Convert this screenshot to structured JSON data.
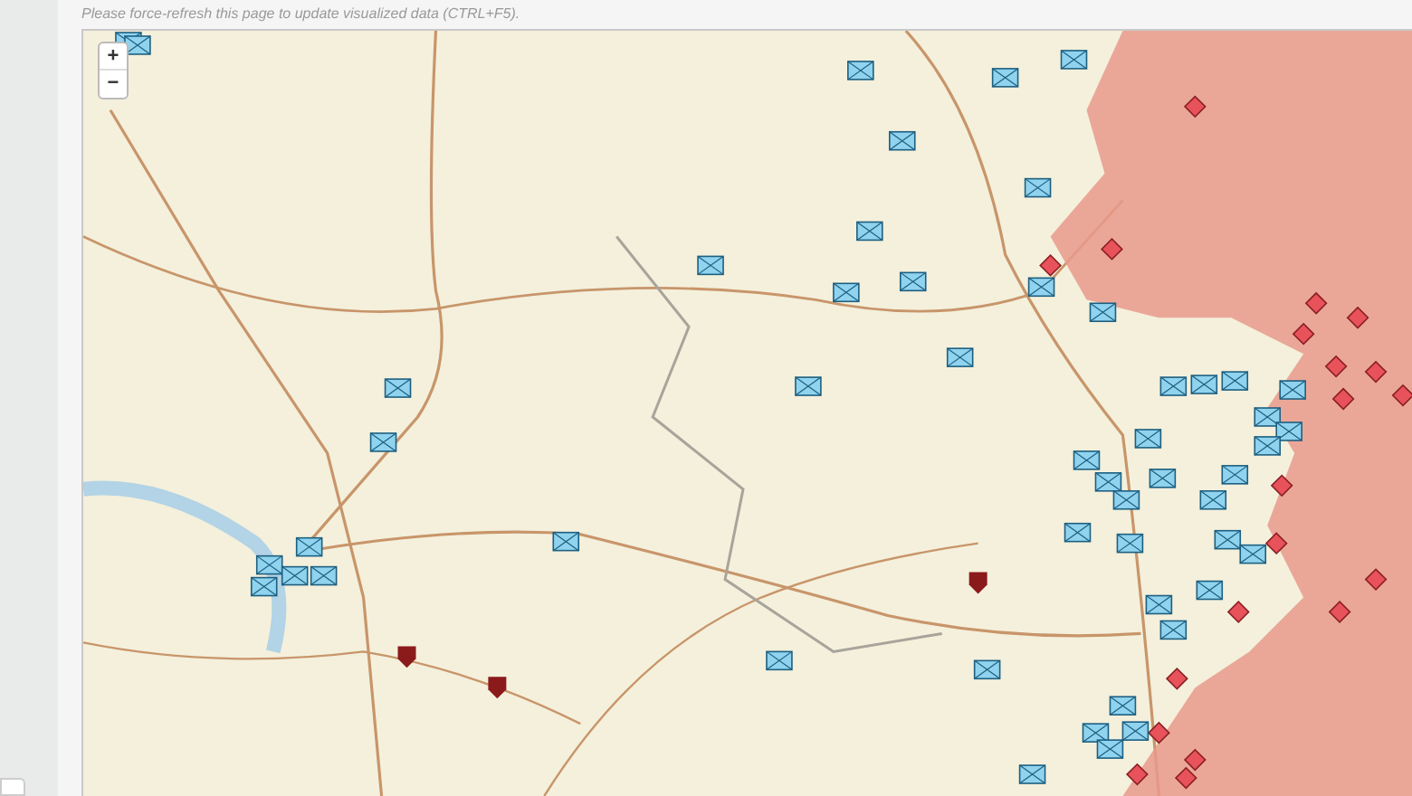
{
  "notice": "Please force-refresh this page to update visualized data (CTRL+F5).",
  "zoom_controls": [
    "+",
    "−"
  ]
}
